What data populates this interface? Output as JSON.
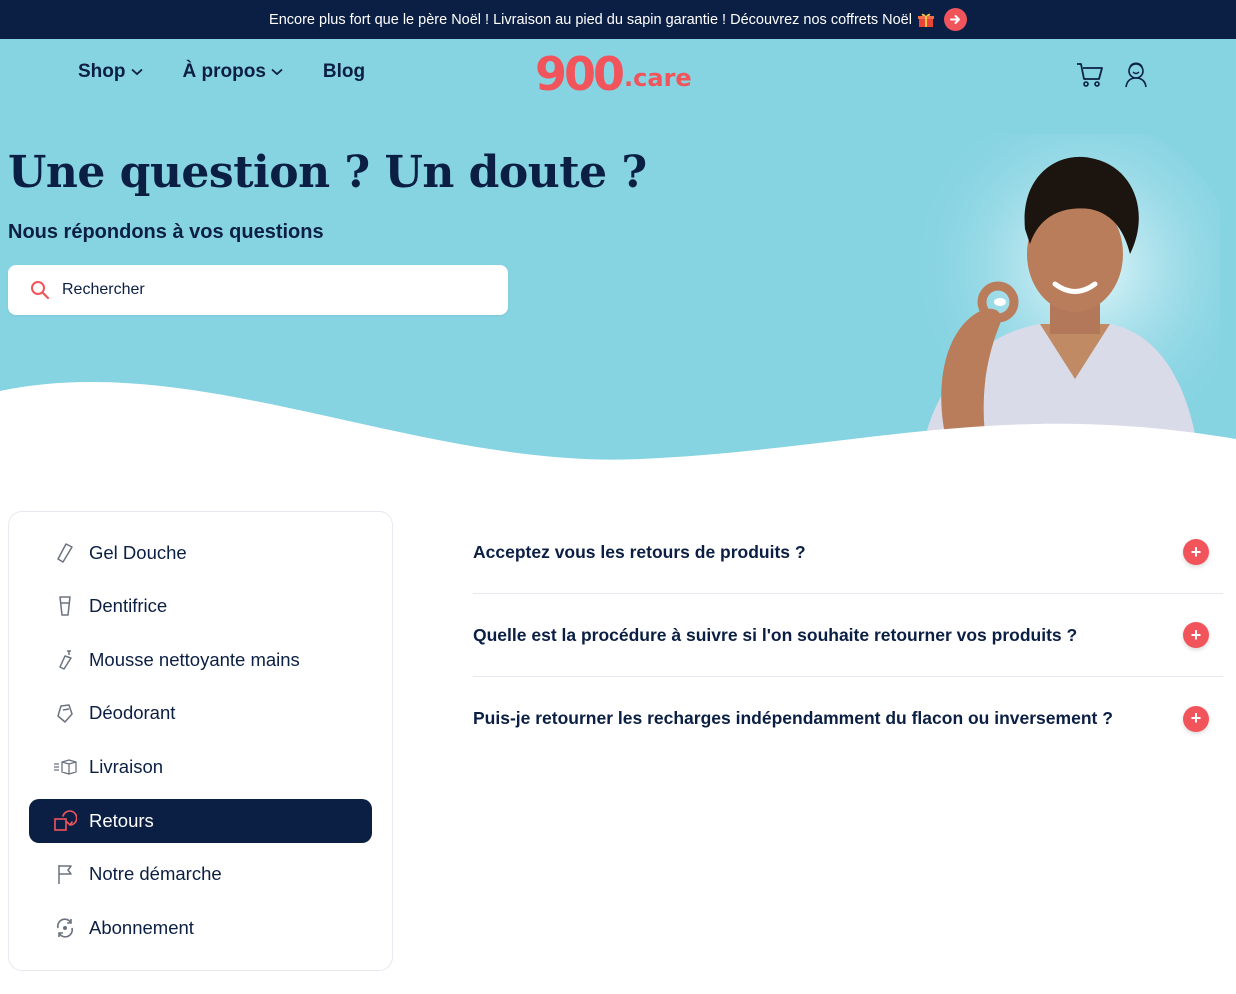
{
  "announcement": {
    "text": "Encore plus fort que le père Noël ! Livraison au pied du sapin garantie ! Découvrez nos coffrets Noël",
    "arrow_icon": "arrow-right-icon"
  },
  "nav": {
    "items": [
      {
        "label": "Shop",
        "dropdown": true
      },
      {
        "label": "À propos",
        "dropdown": true
      },
      {
        "label": "Blog",
        "dropdown": false
      }
    ]
  },
  "logo": {
    "digits": "900",
    "suffix": ".care"
  },
  "header_icons": [
    "cart-icon",
    "account-icon"
  ],
  "hero": {
    "title": "Une question ? Un doute ?",
    "subtitle": "Nous répondons à vos questions"
  },
  "search": {
    "placeholder": "Rechercher",
    "value": ""
  },
  "sidebar": {
    "items": [
      {
        "label": "Gel Douche",
        "icon": "shower-gel-icon",
        "active": false
      },
      {
        "label": "Dentifrice",
        "icon": "toothpaste-icon",
        "active": false
      },
      {
        "label": "Mousse nettoyante mains",
        "icon": "hand-foam-icon",
        "active": false
      },
      {
        "label": "Déodorant",
        "icon": "deodorant-icon",
        "active": false
      },
      {
        "label": "Livraison",
        "icon": "delivery-box-icon",
        "active": false
      },
      {
        "label": "Retours",
        "icon": "return-icon",
        "active": true
      },
      {
        "label": "Notre démarche",
        "icon": "flag-icon",
        "active": false
      },
      {
        "label": "Abonnement",
        "icon": "subscription-icon",
        "active": false
      }
    ]
  },
  "faq": {
    "questions": [
      "Acceptez vous les retours de produits ?",
      "Quelle est la procédure à suivre si l'on souhaite retourner vos produits ?",
      "Puis-je retourner les recharges indépendamment du flacon ou inversement ?"
    ],
    "expand_symbol": "+"
  },
  "colors": {
    "navy": "#0b1f44",
    "hero_blue": "#86d3e2",
    "accent_red": "#f1545a"
  }
}
